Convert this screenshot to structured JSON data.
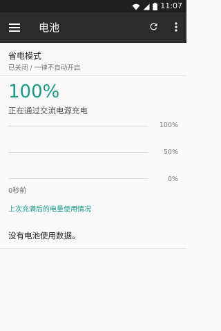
{
  "status_bar": {
    "time": "11:07",
    "icons": [
      "wifi-icon",
      "signal-icon",
      "battery-icon"
    ]
  },
  "app_bar": {
    "title": "电池",
    "icons": [
      "menu-icon",
      "refresh-icon",
      "more-vert-icon"
    ]
  },
  "battery_saver": {
    "title": "省电模式",
    "subtitle": "已关闭 / 一律不自动开启"
  },
  "battery": {
    "percent": "100%",
    "status": "正在通过交流电源充电",
    "graph_labels": [
      "100%",
      "50%",
      "0%"
    ],
    "time_label": "0秒前"
  },
  "usage_link": "上次充满后的电量使用情况",
  "no_data": "没有电池使用数据。",
  "colors": {
    "accent": "#1a9a86",
    "toolbar": "#2b2b2b",
    "statusbar": "#1f1f1f"
  }
}
